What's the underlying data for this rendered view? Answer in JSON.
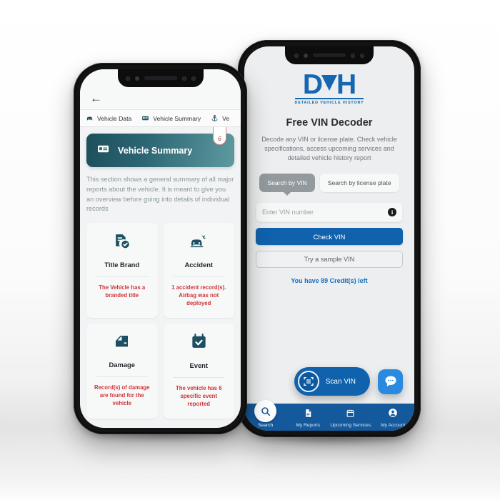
{
  "left_phone": {
    "back_icon": "back-arrow-icon",
    "tabs": [
      {
        "icon": "car-front-icon",
        "label": "Vehicle Data"
      },
      {
        "icon": "id-card-icon",
        "label": "Vehicle Summary"
      },
      {
        "icon": "anchor-icon",
        "label": "Ve"
      }
    ],
    "summary_header": {
      "icon": "id-card-icon",
      "label": "Vehicle Summary",
      "badge": "6"
    },
    "section_description": "This section shows a general summary of all major reports about the vehicle. It is meant to give you an overview before going into details of individual records",
    "cards": [
      {
        "icon": "document-check-icon",
        "title": "Title Brand",
        "status": "The Vehicle has a branded title"
      },
      {
        "icon": "car-crash-icon",
        "title": "Accident",
        "status": "1 accident record(s). Airbag was not deployed"
      },
      {
        "icon": "car-door-icon",
        "title": "Damage",
        "status": "Record(s) of damage are found for the vehicle"
      },
      {
        "icon": "calendar-check-icon",
        "title": "Event",
        "status": "The vehicle has 6 specific event reported"
      }
    ]
  },
  "right_phone": {
    "logo": {
      "letter_d": "D",
      "letter_h": "H",
      "tagline": "DETAILED VEHICLE HISTORY"
    },
    "title": "Free VIN Decoder",
    "description": "Decode any VIN or license plate. Check vehicle specifications, access upcoming services and detailed vehicle history report",
    "segments": [
      {
        "label": "Search by VIN",
        "active": true
      },
      {
        "label": "Search by license plate",
        "active": false
      }
    ],
    "vin_input": {
      "placeholder": "Enter VIN number",
      "value": "",
      "info_icon": "info-icon",
      "info_glyph": "i"
    },
    "check_button": "Check VIN",
    "sample_button": "Try a sample VIN",
    "credits": "You have 89 Credit(s) left",
    "scan_button": {
      "icon": "qr-scan-icon",
      "label": "Scan VIN"
    },
    "chat_button": {
      "icon": "chat-bubble-icon"
    },
    "tabbar": [
      {
        "icon": "search-icon",
        "label": "Search",
        "selected": true
      },
      {
        "icon": "document-icon",
        "label": "My Reports",
        "selected": false
      },
      {
        "icon": "calendar-icon",
        "label": "Upcoming Services",
        "selected": false
      },
      {
        "icon": "user-circle-icon",
        "label": "My Account",
        "selected": false
      }
    ]
  },
  "colors": {
    "brand_blue": "#1667b2",
    "primary_blue": "#1062ad",
    "tabbar_blue": "#14599c",
    "chat_blue": "#2a8ae0",
    "teal_dark": "#1d4f5c",
    "teal_light": "#5e9aa0",
    "status_red": "#d0343a",
    "icon_navy": "#1d4f63"
  }
}
